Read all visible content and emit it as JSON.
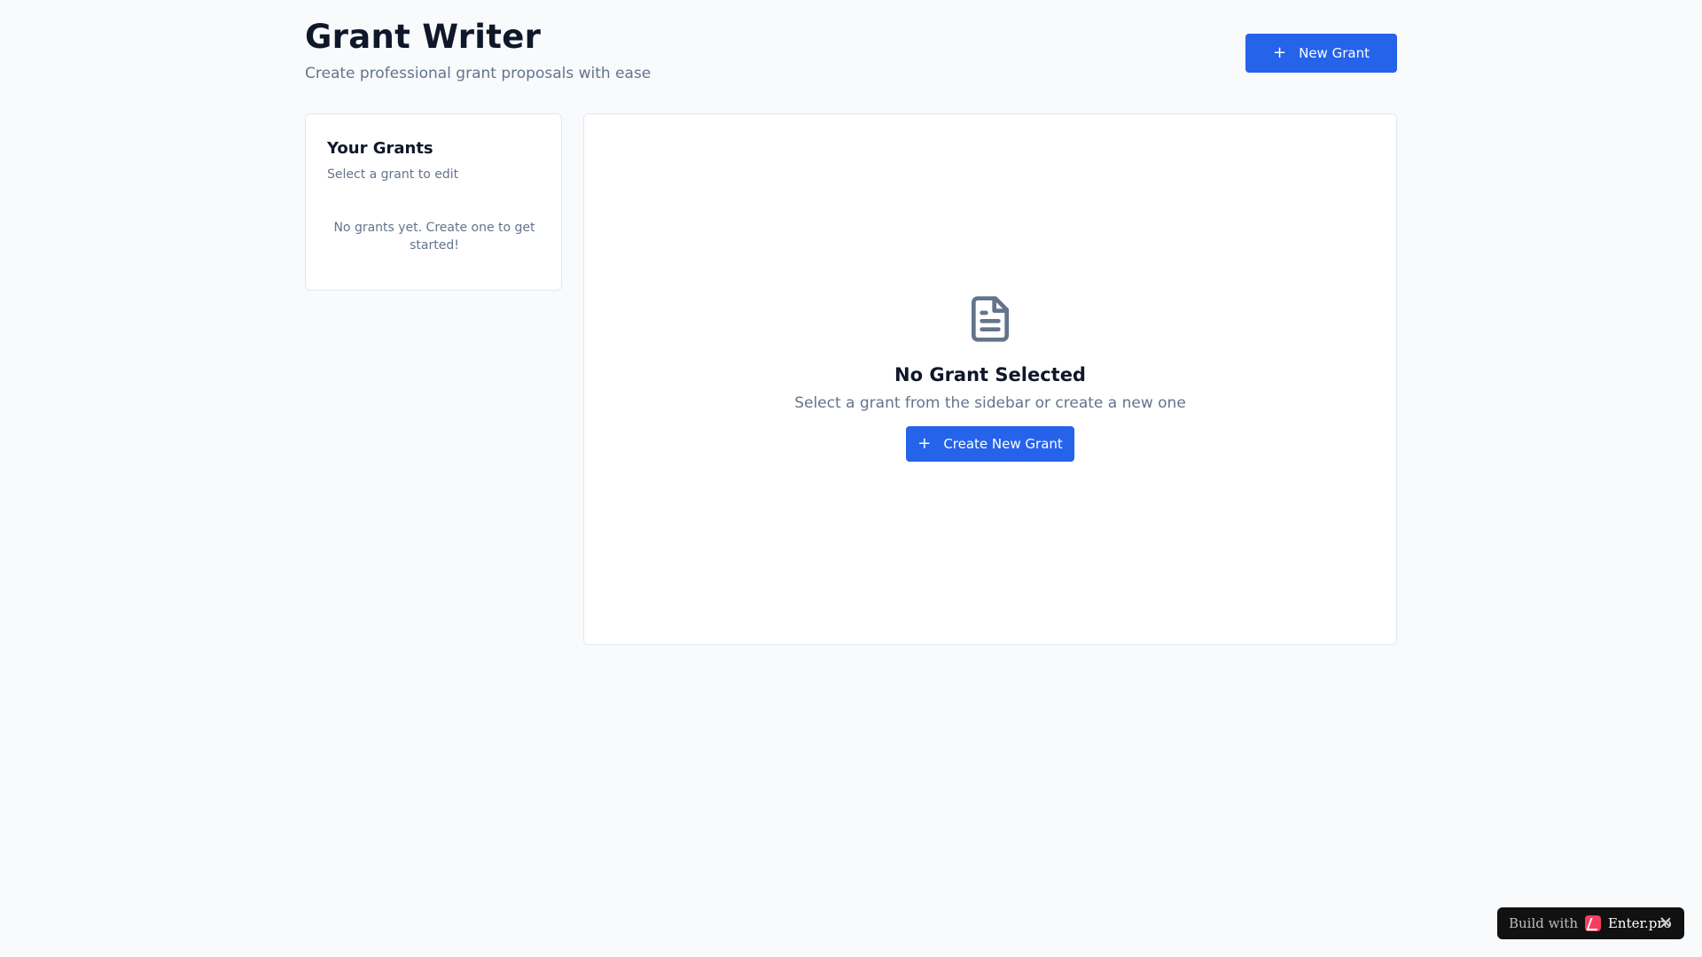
{
  "header": {
    "title": "Grant Writer",
    "subtitle": "Create professional grant proposals with ease",
    "new_grant_label": "New Grant",
    "plus_symbol": "+"
  },
  "sidebar": {
    "title": "Your Grants",
    "subtitle": "Select a grant to edit",
    "empty_message": "No grants yet. Create one to get started!"
  },
  "main": {
    "icon": "file-text-icon",
    "empty_title": "No Grant Selected",
    "empty_description": "Select a grant from the sidebar or create a new one",
    "create_label": "Create New Grant",
    "plus_symbol": "+"
  },
  "badge": {
    "prefix": "Build with",
    "brand": "Enter.pro",
    "logo_icon": "enter-logo-icon",
    "close_icon": "close-icon"
  },
  "colors": {
    "accent": "#2563eb",
    "background": "#f8fafc",
    "muted_text": "#64748b",
    "icon_gray": "#64748b",
    "badge_background": "#111111",
    "badge_logo": "#f43f5e"
  }
}
